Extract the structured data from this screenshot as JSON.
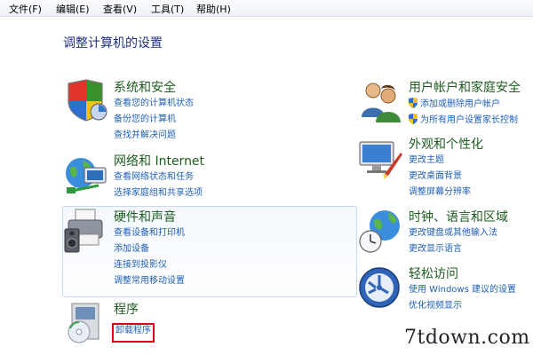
{
  "menubar": {
    "items": [
      "文件(F)",
      "编辑(E)",
      "查看(V)",
      "工具(T)",
      "帮助(H)"
    ]
  },
  "page_title": "调整计算机的设置",
  "left_categories": [
    {
      "title": "系统和安全",
      "icon": "security-shield-icon",
      "links": [
        "查看您的计算机状态",
        "备份您的计算机",
        "查找并解决问题"
      ]
    },
    {
      "title": "网络和 Internet",
      "icon": "network-globe-icon",
      "links": [
        "查看网络状态和任务",
        "选择家庭组和共享选项"
      ]
    },
    {
      "title": "硬件和声音",
      "icon": "printer-speaker-icon",
      "links": [
        "查看设备和打印机",
        "添加设备",
        "连接到投影仪",
        "调整常用移动设置"
      ]
    },
    {
      "title": "程序",
      "icon": "programs-disc-icon",
      "links": [
        "卸载程序"
      ]
    }
  ],
  "right_categories": [
    {
      "title": "用户帐户和家庭安全",
      "icon": "users-icon",
      "links": [
        "添加或删除用户帐户",
        "为所有用户设置家长控制"
      ]
    },
    {
      "title": "外观和个性化",
      "icon": "monitor-paint-icon",
      "links": [
        "更改主题",
        "更改桌面背景",
        "调整屏幕分辨率"
      ]
    },
    {
      "title": "时钟、语言和区域",
      "icon": "clock-globe-icon",
      "links": [
        "更改键盘或其他输入法",
        "更改显示语言"
      ]
    },
    {
      "title": "轻松访问",
      "icon": "accessibility-icon",
      "links": [
        "使用 Windows 建议的设置",
        "优化视频显示"
      ]
    }
  ],
  "watermark": "7tdown.com",
  "colors": {
    "link": "#1f5fb4",
    "category_title": "#1d6b22",
    "highlight": "#e0001a"
  }
}
